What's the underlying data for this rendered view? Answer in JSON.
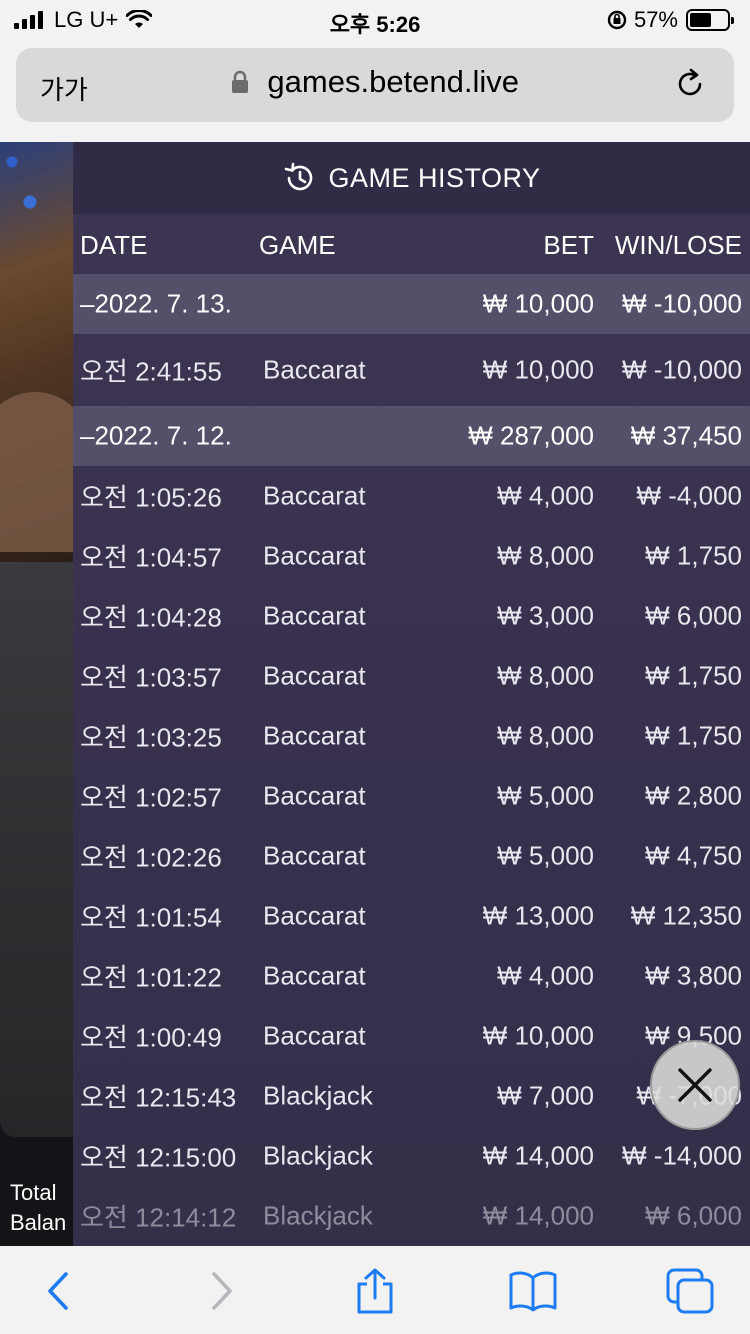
{
  "status_bar": {
    "carrier": "LG U+",
    "time": "오후 5:26",
    "battery_percent": "57%",
    "battery_level": 0.57
  },
  "browser": {
    "text_size_label": "가가",
    "url": "games.betend.live"
  },
  "background": {
    "total_label": "Total",
    "balance_label": "Balan"
  },
  "modal": {
    "title": "GAME HISTORY",
    "columns": {
      "date": "DATE",
      "game": "GAME",
      "bet": "BET",
      "win_lose": "WIN/LOSE"
    },
    "rows": [
      {
        "type": "day",
        "date": "–2022. 7. 13.",
        "game": "",
        "bet": "₩ 10,000",
        "win_lose": "₩ -10,000"
      },
      {
        "type": "game",
        "date": "오전 2:41:55",
        "game": "Baccarat",
        "bet": "₩ 10,000",
        "win_lose": "₩ -10,000"
      },
      {
        "type": "day",
        "date": "–2022. 7. 12.",
        "game": "",
        "bet": "₩ 287,000",
        "win_lose": "₩ 37,450"
      },
      {
        "type": "game",
        "date": "오전 1:05:26",
        "game": "Baccarat",
        "bet": "₩ 4,000",
        "win_lose": "₩ -4,000"
      },
      {
        "type": "game",
        "date": "오전 1:04:57",
        "game": "Baccarat",
        "bet": "₩ 8,000",
        "win_lose": "₩ 1,750"
      },
      {
        "type": "game",
        "date": "오전 1:04:28",
        "game": "Baccarat",
        "bet": "₩ 3,000",
        "win_lose": "₩ 6,000"
      },
      {
        "type": "game",
        "date": "오전 1:03:57",
        "game": "Baccarat",
        "bet": "₩ 8,000",
        "win_lose": "₩ 1,750"
      },
      {
        "type": "game",
        "date": "오전 1:03:25",
        "game": "Baccarat",
        "bet": "₩ 8,000",
        "win_lose": "₩ 1,750"
      },
      {
        "type": "game",
        "date": "오전 1:02:57",
        "game": "Baccarat",
        "bet": "₩ 5,000",
        "win_lose": "₩ 2,800"
      },
      {
        "type": "game",
        "date": "오전 1:02:26",
        "game": "Baccarat",
        "bet": "₩ 5,000",
        "win_lose": "₩ 4,750"
      },
      {
        "type": "game",
        "date": "오전 1:01:54",
        "game": "Baccarat",
        "bet": "₩ 13,000",
        "win_lose": "₩ 12,350"
      },
      {
        "type": "game",
        "date": "오전 1:01:22",
        "game": "Baccarat",
        "bet": "₩ 4,000",
        "win_lose": "₩ 3,800"
      },
      {
        "type": "game",
        "date": "오전 1:00:49",
        "game": "Baccarat",
        "bet": "₩ 10,000",
        "win_lose": "₩ 9,500"
      },
      {
        "type": "game",
        "date": "오전 12:15:43",
        "game": "Blackjack",
        "bet": "₩ 7,000",
        "win_lose": "₩ -7,000"
      },
      {
        "type": "game",
        "date": "오전 12:15:00",
        "game": "Blackjack",
        "bet": "₩ 14,000",
        "win_lose": "₩ -14,000"
      },
      {
        "type": "game",
        "date": "오전 12:14:12",
        "game": "Blackjack",
        "bet": "₩ 14,000",
        "win_lose": "₩ 6,000"
      }
    ]
  },
  "icons": {
    "history": "history-icon",
    "close": "close-icon",
    "back": "chevron-left-icon",
    "forward": "chevron-right-icon",
    "share": "share-icon",
    "bookmarks": "book-icon",
    "tabs": "tabs-icon"
  },
  "colors": {
    "modal_background": "#3a324f",
    "day_row": "#54506a",
    "ios_blue": "#1e7cf2"
  }
}
